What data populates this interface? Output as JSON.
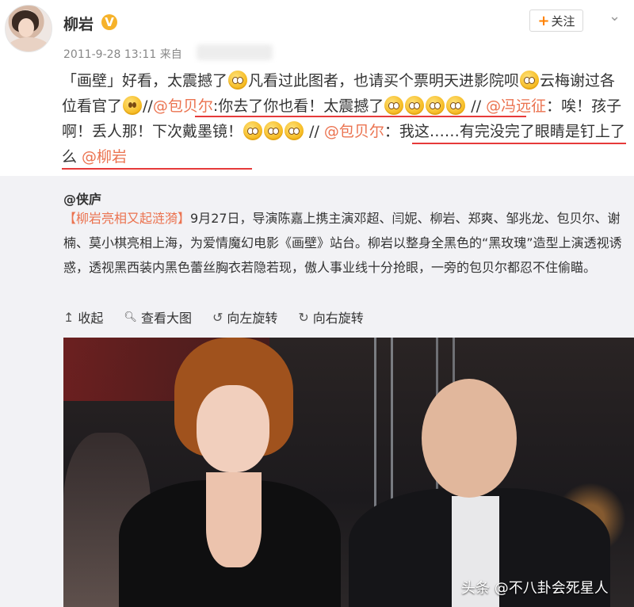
{
  "post": {
    "username": "柳岩",
    "verified_badge": "V",
    "follow_label": "关注",
    "timestamp": "2011-9-28 13:11",
    "source_prefix": "来自",
    "text": {
      "p1": "「画壁」好看，太震撼了",
      "p2": "凡看过此图者，也请买个票明天进影院呗",
      "p3": "云梅谢过各位看官了",
      "p4": "//",
      "m1": "@包贝尔",
      "p5": ":你去了你也看！太震撼了",
      "p6": " // ",
      "m2": "@冯远征",
      "p7": "：唉！孩子啊！丢人那！下次戴墨镜！",
      "p8": " // ",
      "m3": "@包贝尔",
      "p9": "：我这……有完没完了眼睛是钉上了么 ",
      "m4": "@柳岩"
    }
  },
  "repost": {
    "author": "@侠庐",
    "topic": "【柳岩亮相又起涟漪】",
    "body": "9月27日，导演陈嘉上携主演邓超、闫妮、柳岩、郑爽、邹兆龙、包贝尔、谢楠、莫小棋亮相上海，为爱情魔幻电影《画壁》站台。柳岩以整身全黑色的“黑玫瑰”造型上演透视诱惑，透视黑西装内黑色蕾丝胸衣若隐若现，傲人事业线十分抢眼，一旁的包贝尔都忍不住偷瞄。",
    "actions": [
      {
        "icon": "↥",
        "label": "收起"
      },
      {
        "icon": "🔍",
        "label": "查看大图"
      },
      {
        "icon": "↺",
        "label": "向左旋转"
      },
      {
        "icon": "↻",
        "label": "向右旋转"
      }
    ]
  },
  "watermark": "头条 @不八卦会死星人",
  "colors": {
    "mention": "#eb7350",
    "annotation_underline": "#e63a3a",
    "verified": "#f6b22a",
    "follow_plus": "#ff8200"
  }
}
